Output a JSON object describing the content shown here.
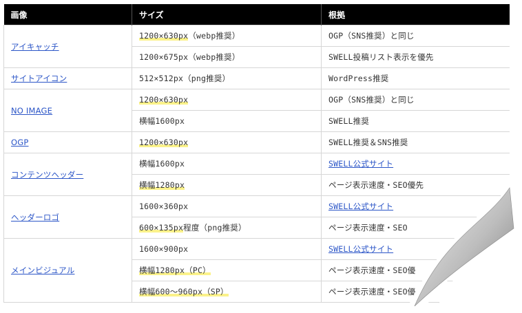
{
  "headers": [
    "画像",
    "サイズ",
    "根拠"
  ],
  "groups": [
    {
      "name": "アイキャッチ",
      "rows": [
        {
          "size": "1200×630px",
          "size_rest": "（webp推奨）",
          "hl": true,
          "basis": "OGP（SNS推奨）と同じ",
          "link": false
        },
        {
          "size": "",
          "size_rest": "1200×675px（webp推奨）",
          "hl": false,
          "basis": "SWELL投稿リスト表示を優先",
          "link": false
        }
      ]
    },
    {
      "name": "サイトアイコン",
      "rows": [
        {
          "size": "",
          "size_rest": "512×512px（png推奨）",
          "hl": false,
          "basis": "WordPress推奨",
          "link": false
        }
      ]
    },
    {
      "name": "NO IMAGE",
      "rows": [
        {
          "size": "1200×630px",
          "size_rest": "",
          "hl": true,
          "basis": "OGP（SNS推奨）と同じ",
          "link": false
        },
        {
          "size": "",
          "size_rest": "横幅1600px",
          "hl": false,
          "basis": "SWELL推奨",
          "link": false
        }
      ]
    },
    {
      "name": "OGP",
      "rows": [
        {
          "size": "1200×630px",
          "size_rest": "",
          "hl": true,
          "basis": "SWELL推奨＆SNS推奨",
          "link": false
        }
      ]
    },
    {
      "name": "コンテンツヘッダー",
      "rows": [
        {
          "size": "",
          "size_rest": "横幅1600px",
          "hl": false,
          "basis": "SWELL公式サイト",
          "link": true
        },
        {
          "size": "横幅1280px",
          "size_rest": "",
          "hl": true,
          "basis": "ページ表示速度・SEO優先",
          "link": false
        }
      ]
    },
    {
      "name": "ヘッダーロゴ",
      "rows": [
        {
          "size": "",
          "size_rest": "1600×360px",
          "hl": false,
          "basis": "SWELL公式サイト",
          "link": true
        },
        {
          "size": "600×135px",
          "size_rest": "程度（png推奨）",
          "hl": true,
          "basis": "ページ表示速度・SEO",
          "link": false
        }
      ]
    },
    {
      "name": "メインビジュアル",
      "rows": [
        {
          "size": "",
          "size_rest": "1600×900px",
          "hl": false,
          "basis": "SWELL公式サイト",
          "link": true
        },
        {
          "size": "横幅1280px（PC）",
          "size_rest": "",
          "hl": true,
          "basis": "ページ表示速度・SEO優",
          "link": false
        },
        {
          "size": "横幅600～960px（SP）",
          "size_rest": "",
          "hl": true,
          "basis": "ページ表示速度・SEO優",
          "link": false
        }
      ]
    }
  ]
}
